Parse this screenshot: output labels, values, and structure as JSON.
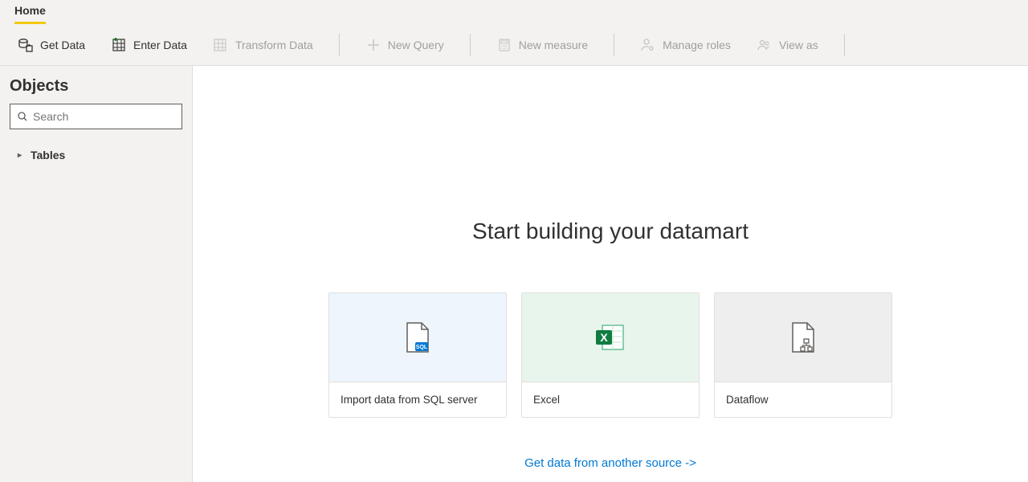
{
  "tabs": {
    "home": "Home"
  },
  "ribbon": {
    "get_data": "Get Data",
    "enter_data": "Enter Data",
    "transform_data": "Transform Data",
    "new_query": "New Query",
    "new_measure": "New measure",
    "manage_roles": "Manage roles",
    "view_as": "View as"
  },
  "sidebar": {
    "title": "Objects",
    "search_placeholder": "Search",
    "tree": {
      "tables": "Tables"
    }
  },
  "main": {
    "hero_title": "Start building your datamart",
    "cards": {
      "sql": "Import data from SQL server",
      "excel": "Excel",
      "dataflow": "Dataflow"
    },
    "another_source": "Get data from another source ->"
  }
}
